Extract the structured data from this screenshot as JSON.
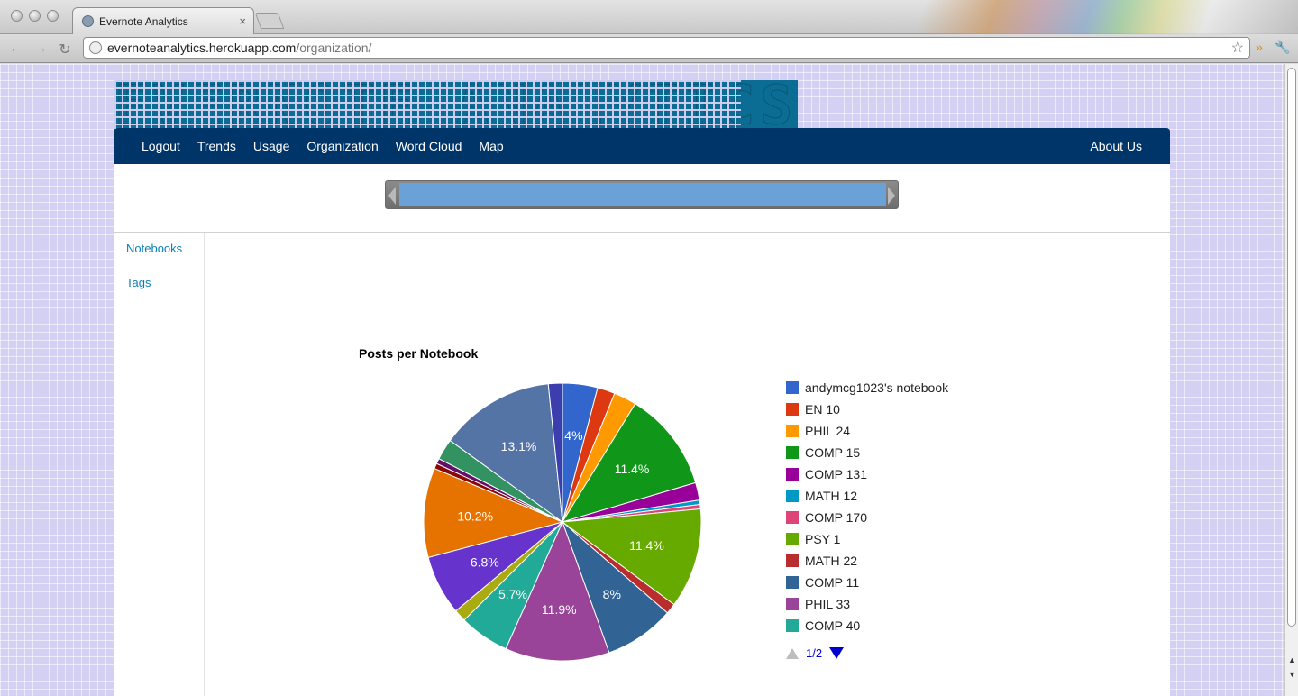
{
  "browser": {
    "tab_title": "Evernote Analytics",
    "tab_close": "×",
    "url_host": "evernoteanalytics.herokuapp.com",
    "url_path": "/organization/"
  },
  "site": {
    "logo_text": "EVERNOTE ANALYTICS",
    "nav": [
      "Logout",
      "Trends",
      "Usage",
      "Organization",
      "Word Cloud",
      "Map"
    ],
    "nav_right": "About Us"
  },
  "sidebar": {
    "items": [
      "Notebooks",
      "Tags"
    ]
  },
  "pager": {
    "label": "1/2"
  },
  "chart_data": {
    "type": "pie",
    "title": "Posts per Notebook",
    "slices": [
      {
        "label": "andymcg1023's notebook",
        "value": 4.0,
        "color": "#3366cc",
        "show": "4%"
      },
      {
        "label": "EN 10",
        "value": 2.0,
        "color": "#dc3912",
        "show": ""
      },
      {
        "label": "PHIL 24",
        "value": 2.6,
        "color": "#ff9900",
        "show": ""
      },
      {
        "label": "COMP 15",
        "value": 11.4,
        "color": "#109618",
        "show": "11.4%"
      },
      {
        "label": "COMP 131",
        "value": 2.0,
        "color": "#990099",
        "show": ""
      },
      {
        "label": "MATH 12",
        "value": 0.5,
        "color": "#0099c6",
        "show": ""
      },
      {
        "label": "COMP 170",
        "value": 0.5,
        "color": "#dd4477",
        "show": ""
      },
      {
        "label": "PSY 1",
        "value": 11.4,
        "color": "#66aa00",
        "show": "11.4%"
      },
      {
        "label": "MATH 22",
        "value": 1.2,
        "color": "#b82e2e",
        "show": ""
      },
      {
        "label": "COMP 11",
        "value": 8.0,
        "color": "#316395",
        "show": "8%"
      },
      {
        "label": "PHIL 33",
        "value": 11.9,
        "color": "#994499",
        "show": "11.9%"
      },
      {
        "label": "COMP 40",
        "value": 5.7,
        "color": "#22aa99",
        "show": "5.7%"
      },
      {
        "label": "",
        "value": 1.4,
        "color": "#aaaa11",
        "show": ""
      },
      {
        "label": "",
        "value": 6.8,
        "color": "#6633cc",
        "show": "6.8%"
      },
      {
        "label": "",
        "value": 10.2,
        "color": "#e67300",
        "show": "10.2%"
      },
      {
        "label": "",
        "value": 0.6,
        "color": "#8b0707",
        "show": ""
      },
      {
        "label": "",
        "value": 0.6,
        "color": "#651067",
        "show": ""
      },
      {
        "label": "",
        "value": 2.4,
        "color": "#329262",
        "show": ""
      },
      {
        "label": "",
        "value": 13.1,
        "color": "#5574a6",
        "show": "13.1%"
      },
      {
        "label": "",
        "value": 1.6,
        "color": "#3b3eac",
        "show": ""
      }
    ],
    "legend_visible": 12
  }
}
